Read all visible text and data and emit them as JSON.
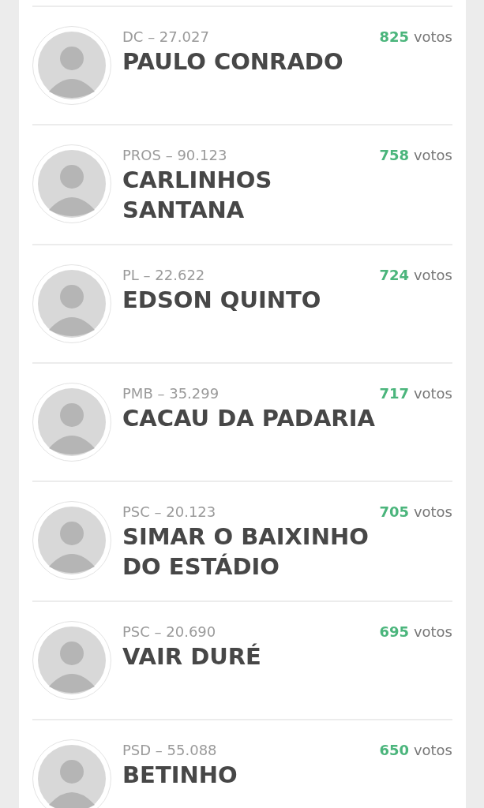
{
  "candidates": [
    {
      "party": "DC – 27.027",
      "name": "PAULO CONRADO",
      "votes": "825",
      "votes_label": "votos"
    },
    {
      "party": "PROS – 90.123",
      "name": "CARLINHOS SANTANA",
      "votes": "758",
      "votes_label": "votos"
    },
    {
      "party": "PL – 22.622",
      "name": "EDSON QUINTO",
      "votes": "724",
      "votes_label": "votos"
    },
    {
      "party": "PMB – 35.299",
      "name": "CACAU DA PADARIA",
      "votes": "717",
      "votes_label": "votos"
    },
    {
      "party": "PSC – 20.123",
      "name": "SIMAR O BAIXINHO DO ESTÁDIO",
      "votes": "705",
      "votes_label": "votos"
    },
    {
      "party": "PSC – 20.690",
      "name": "VAIR DURÉ",
      "votes": "695",
      "votes_label": "votos"
    },
    {
      "party": "PSD – 55.088",
      "name": "BETINHO",
      "votes": "650",
      "votes_label": "votos"
    }
  ]
}
